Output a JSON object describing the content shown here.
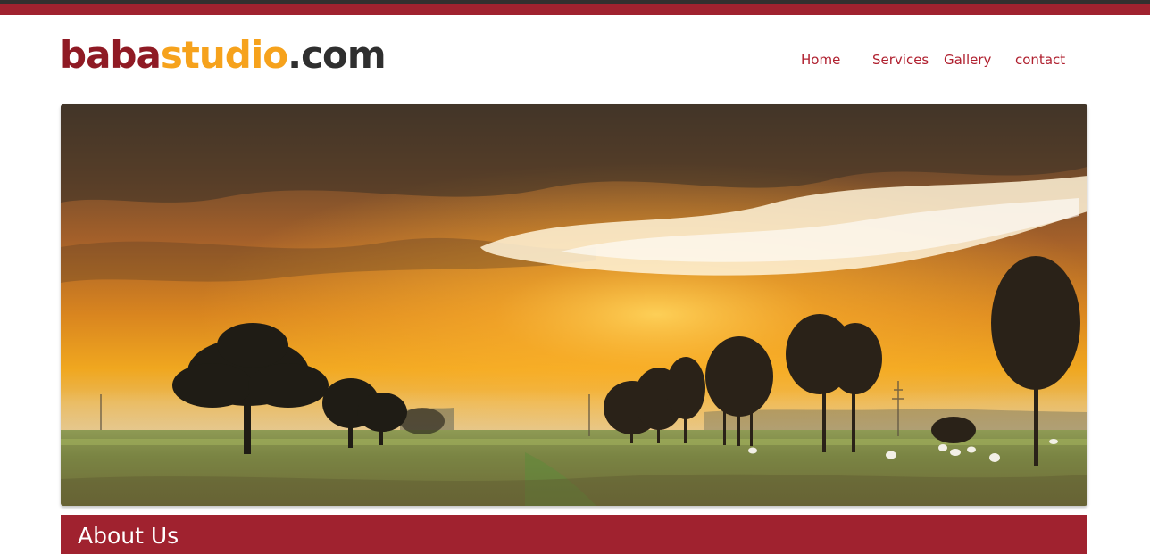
{
  "logo": {
    "part_1": "baba",
    "part_2": "studio",
    "part_3": ".com"
  },
  "nav": {
    "items": [
      {
        "label": "Home"
      },
      {
        "label": "Services"
      },
      {
        "label": "Gallery"
      },
      {
        "label": "contact"
      }
    ]
  },
  "hero": {
    "image": "sunset-landscape-photo"
  },
  "about": {
    "heading": "About Us"
  },
  "colors": {
    "brand_red": "#a0222f",
    "logo_dark_red": "#8f1a24",
    "logo_orange": "#f6a21c",
    "logo_dark": "#2f2f2f",
    "nav_link": "#b0202f"
  }
}
